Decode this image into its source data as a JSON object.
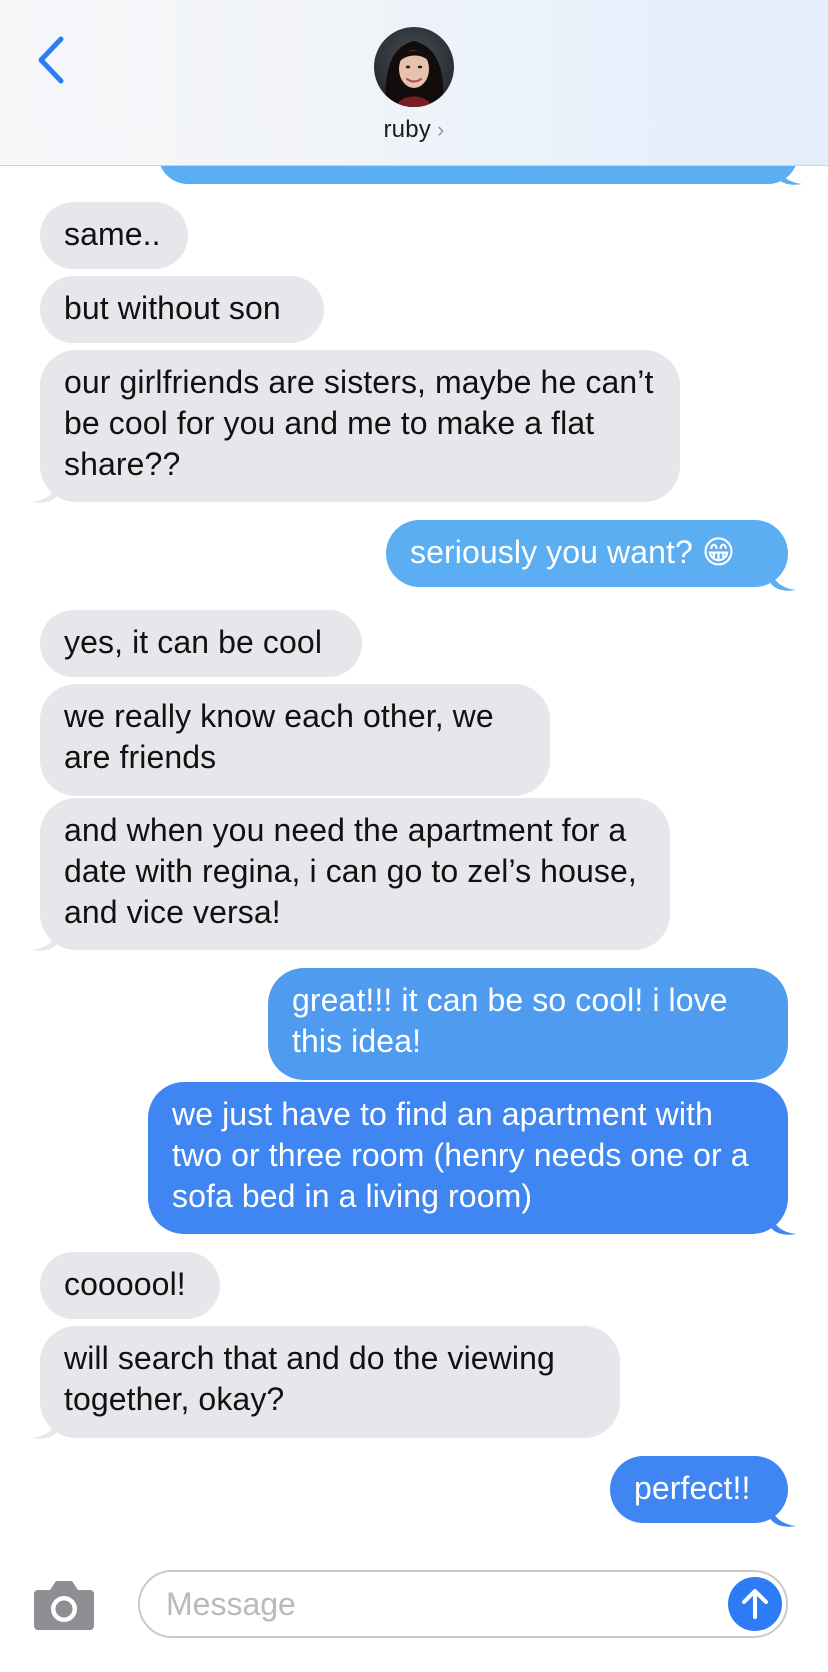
{
  "header": {
    "contact_name": "ruby",
    "name_chevron": "›",
    "back_icon": "chevron-left-icon"
  },
  "messages": [
    {
      "from": "contact",
      "text": "same.."
    },
    {
      "from": "contact",
      "text": "but without son"
    },
    {
      "from": "contact",
      "text": "our girlfriends are sisters, maybe he can’t be cool for you and me to make a flat share??"
    },
    {
      "from": "me",
      "text": "seriously you want? 😁"
    },
    {
      "from": "contact",
      "text": "yes, it can be cool"
    },
    {
      "from": "contact",
      "text": "we really know each other, we are friends"
    },
    {
      "from": "contact",
      "text": "and when you need the apartment for a date with regina, i can go to zel’s house, and vice versa!"
    },
    {
      "from": "me",
      "text": "great!!! it can be so cool! i love this idea!"
    },
    {
      "from": "me",
      "text": "we just have to find an apartment with two or three room (henry needs one or a sofa bed in a living room)"
    },
    {
      "from": "contact",
      "text": "coooool!"
    },
    {
      "from": "contact",
      "text": "will search that and do the viewing together, okay?"
    },
    {
      "from": "me",
      "text": "perfect!!"
    }
  ],
  "input_bar": {
    "placeholder": "Message",
    "camera_icon": "camera-icon",
    "send_icon": "arrow-up-icon"
  },
  "colors": {
    "received_bubble": "#e6e6eb",
    "sent_bubble_light": "#5aaef1",
    "sent_bubble_dark": "#3f86f2",
    "accent": "#2d7cf6"
  }
}
